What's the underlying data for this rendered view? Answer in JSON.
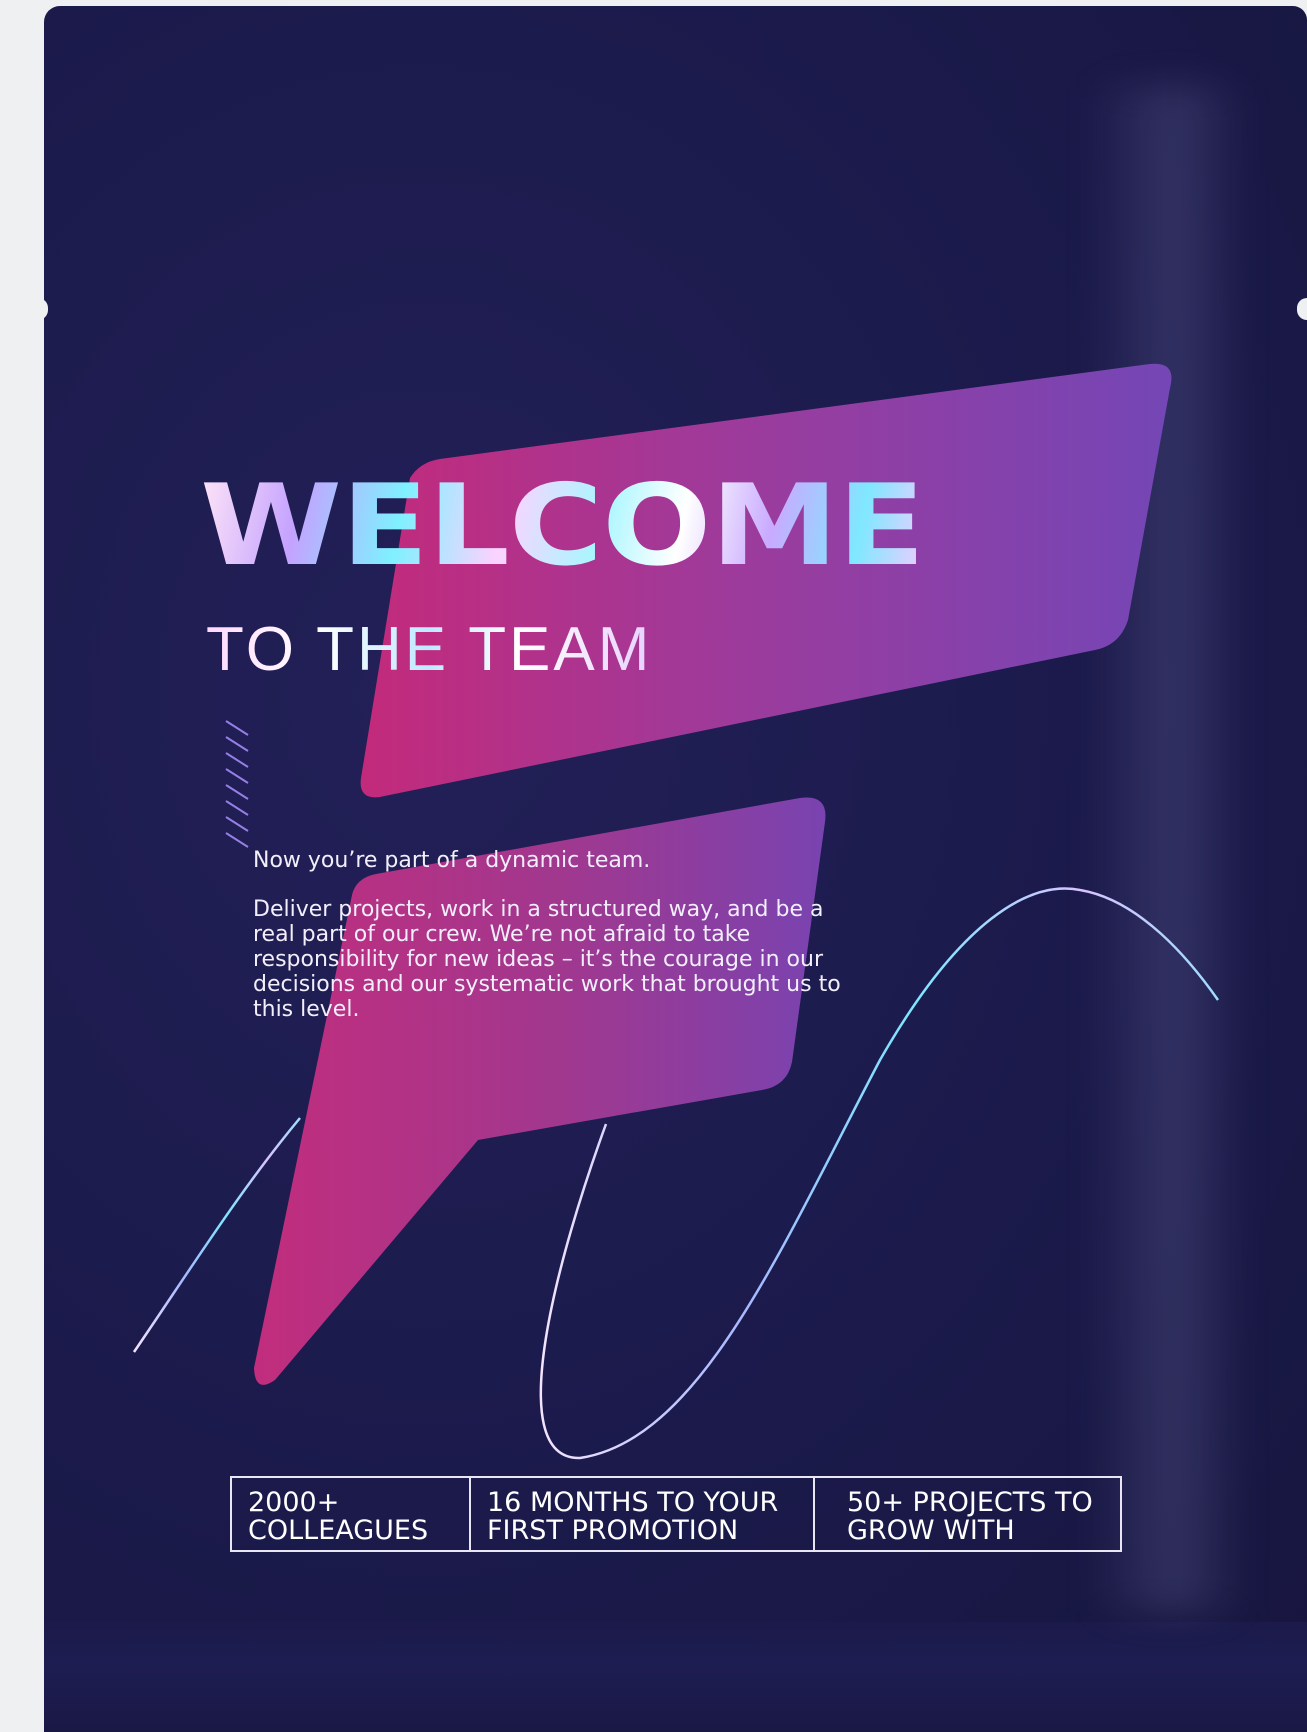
{
  "headline": {
    "welcome": "WELCOME",
    "subtitle": "TO THE TEAM"
  },
  "intro_text": "Now you’re part of a dynamic team.",
  "body_text": "Deliver projects, work in a structured way, and be a real part of our crew. We’re not afraid to take responsibility for new ideas – it’s the courage in our decisions and our systematic work that brought us to this level.",
  "stats": [
    {
      "line1": "2000+",
      "line2": "COLLEAGUES"
    },
    {
      "line1": "16 MONTHS TO YOUR",
      "line2": "FIRST PROMOTION"
    },
    {
      "line1": "50+ PROJECTS TO",
      "line2": "GROW WITH"
    }
  ],
  "colors": {
    "pouch": "#1b1a4b",
    "accent_magenta": "#c0307f",
    "accent_purple": "#7a45b8",
    "text": "#ffffff"
  }
}
